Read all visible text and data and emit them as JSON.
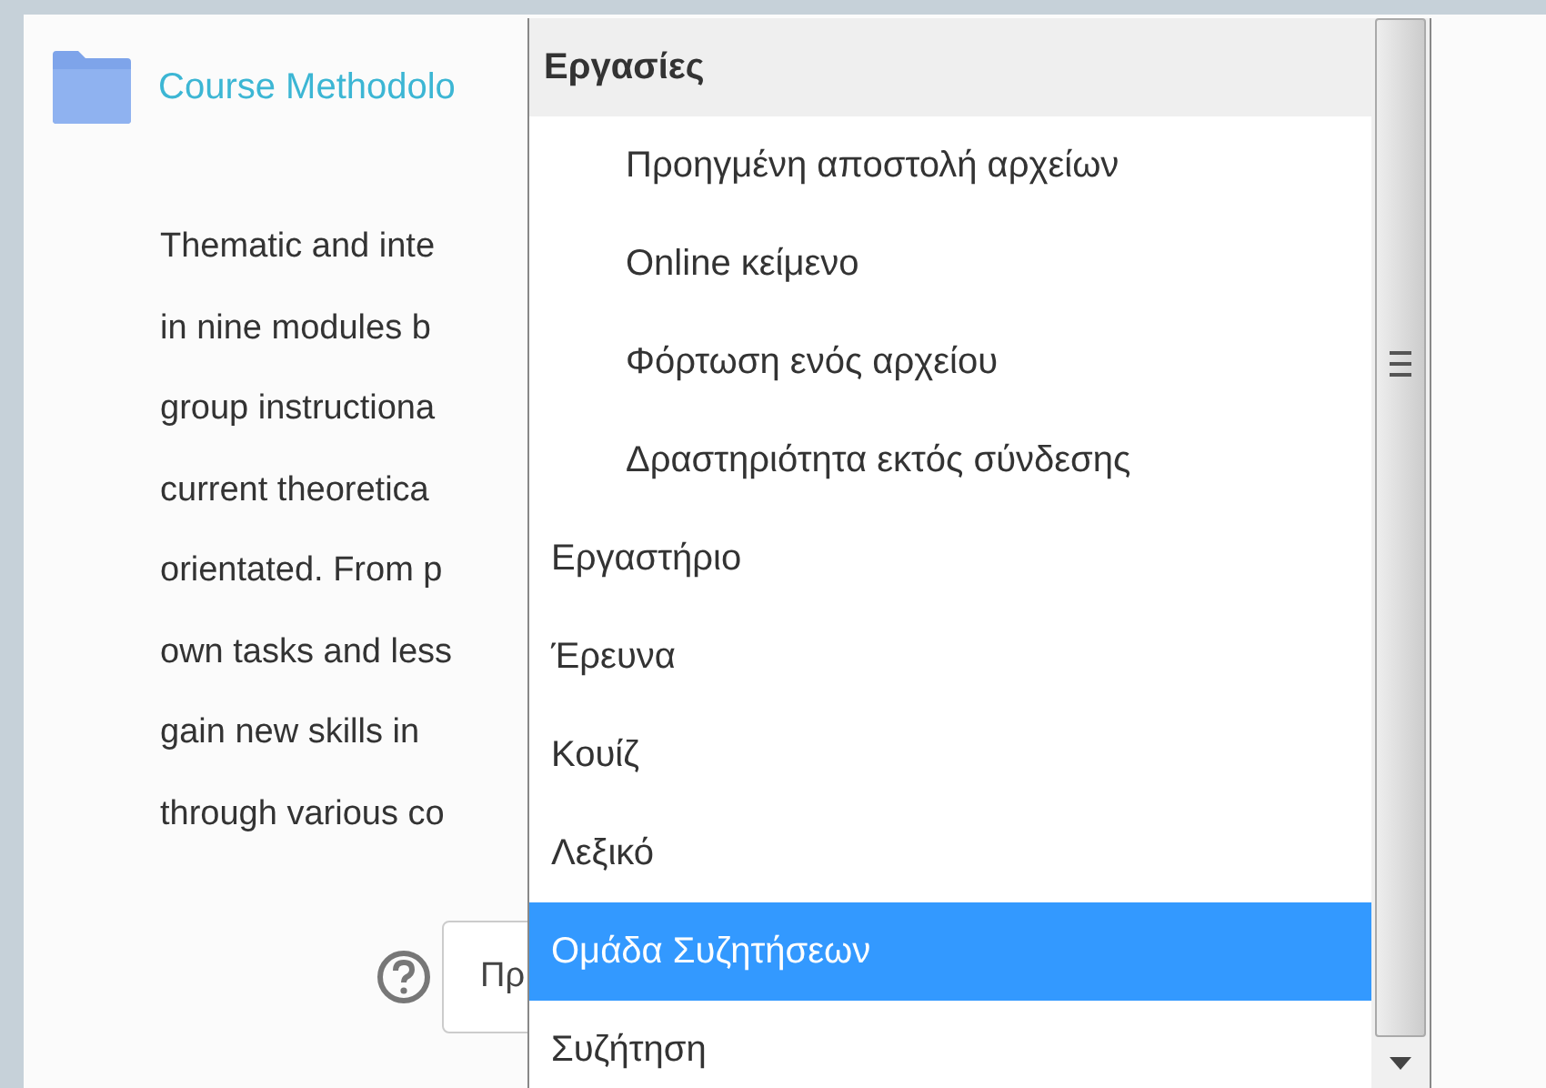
{
  "section": {
    "title": "Course Methodolo",
    "description_lines": [
      "Thematic and inte",
      "in nine modules b",
      "group instructiona",
      "current theoretica",
      "orientated. From p",
      "own tasks and less",
      "gain new skills in",
      "through various co"
    ]
  },
  "select": {
    "value": "Πρ"
  },
  "dropdown": {
    "items": [
      {
        "kind": "group",
        "label": "Εργασίες",
        "selected": false,
        "children": [
          {
            "label": "Προηγμένη αποστολή αρχείων",
            "selected": false
          },
          {
            "label": "Online κείμενο",
            "selected": false
          },
          {
            "label": "Φόρτωση ενός αρχείου",
            "selected": false
          },
          {
            "label": "Δραστηριότητα εκτός σύνδεσης",
            "selected": false
          }
        ]
      },
      {
        "kind": "option",
        "label": "Εργαστήριο",
        "selected": false
      },
      {
        "kind": "option",
        "label": "Έρευνα",
        "selected": false
      },
      {
        "kind": "option",
        "label": "Κουίζ",
        "selected": false
      },
      {
        "kind": "option",
        "label": "Λεξικό",
        "selected": false
      },
      {
        "kind": "option",
        "label": "Ομάδα Συζητήσεων",
        "selected": true
      },
      {
        "kind": "option",
        "label": "Συζήτηση",
        "selected": false
      }
    ]
  }
}
